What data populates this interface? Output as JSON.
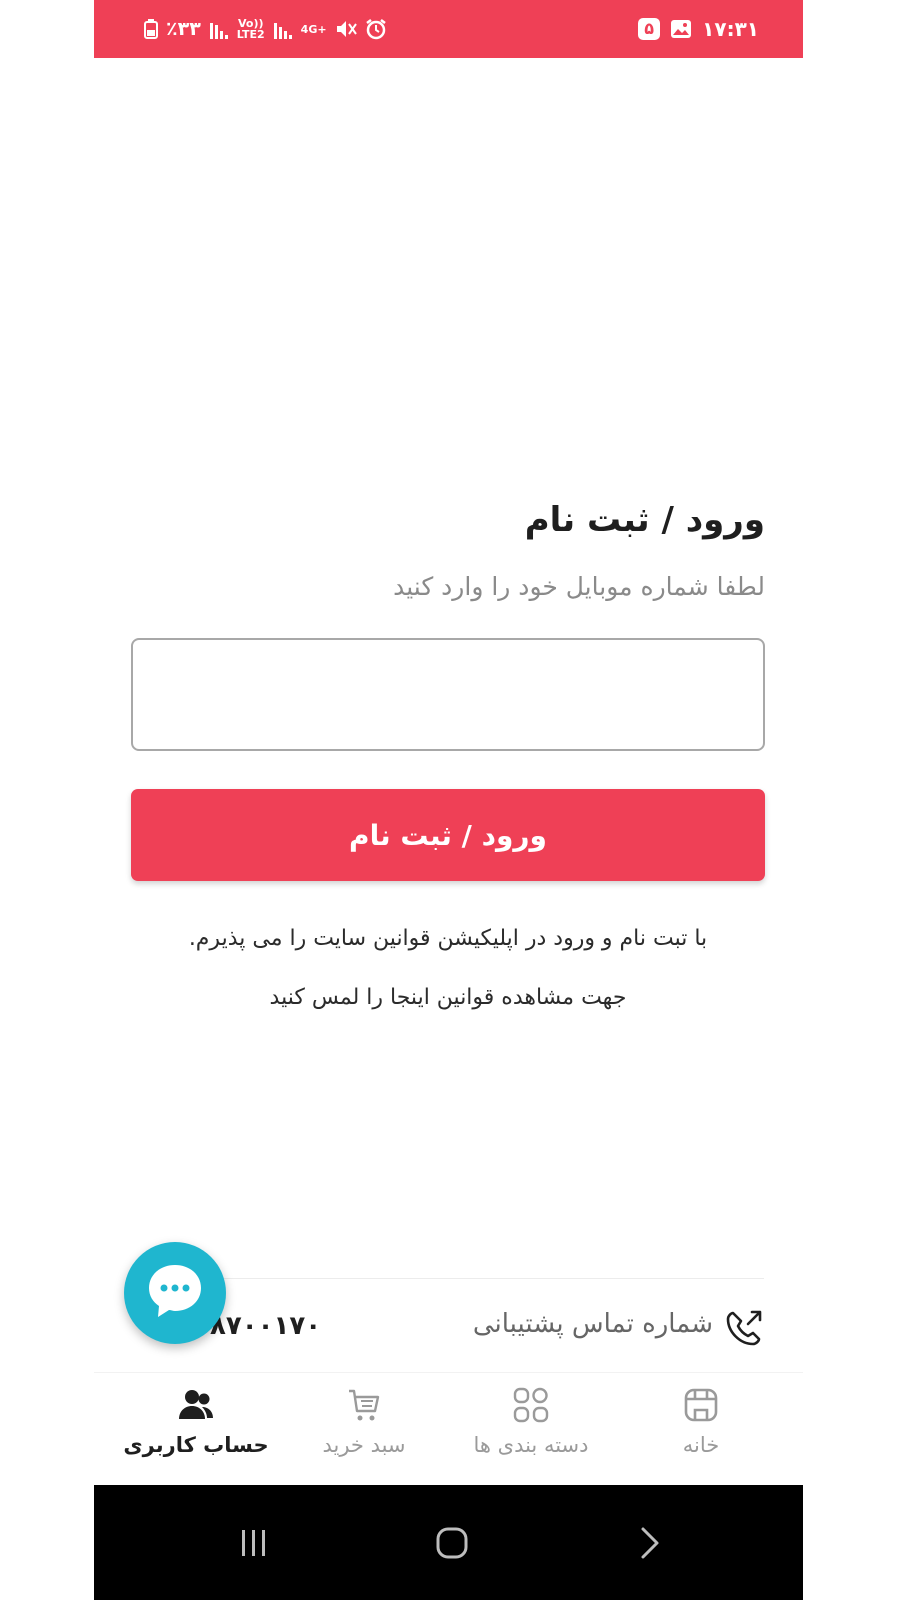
{
  "status_bar": {
    "battery": "٪۳۳",
    "volte": "Vo))",
    "lte2": "LTE2",
    "network": "4G+",
    "time": "۱۷:۳۱",
    "notification_count": "۵"
  },
  "login": {
    "title": "ورود / ثبت نام",
    "subtitle": "لطفا شماره موبایل خود را وارد کنید",
    "phone_value": "",
    "button_label": "ورود / ثبت نام",
    "terms_line1": "با تبت نام و ورود در اپلیکیشن قوانین سایت را می پذیرم.",
    "terms_line2": "جهت مشاهده قوانین اینجا را لمس کنید"
  },
  "support": {
    "label": "شماره تماس پشتیبانی",
    "number_visible": "۸۷۰۰۱۷۰"
  },
  "bottom_nav": {
    "items": [
      {
        "label": "خانه",
        "icon": "store-icon"
      },
      {
        "label": "دسته بندی ها",
        "icon": "categories-grid-icon"
      },
      {
        "label": "سبد خرید",
        "icon": "cart-icon"
      },
      {
        "label": "حساب کاربری",
        "icon": "users-icon",
        "active": true
      }
    ]
  },
  "colors": {
    "brand": "#ef4056",
    "chat": "#1fb6cf"
  }
}
